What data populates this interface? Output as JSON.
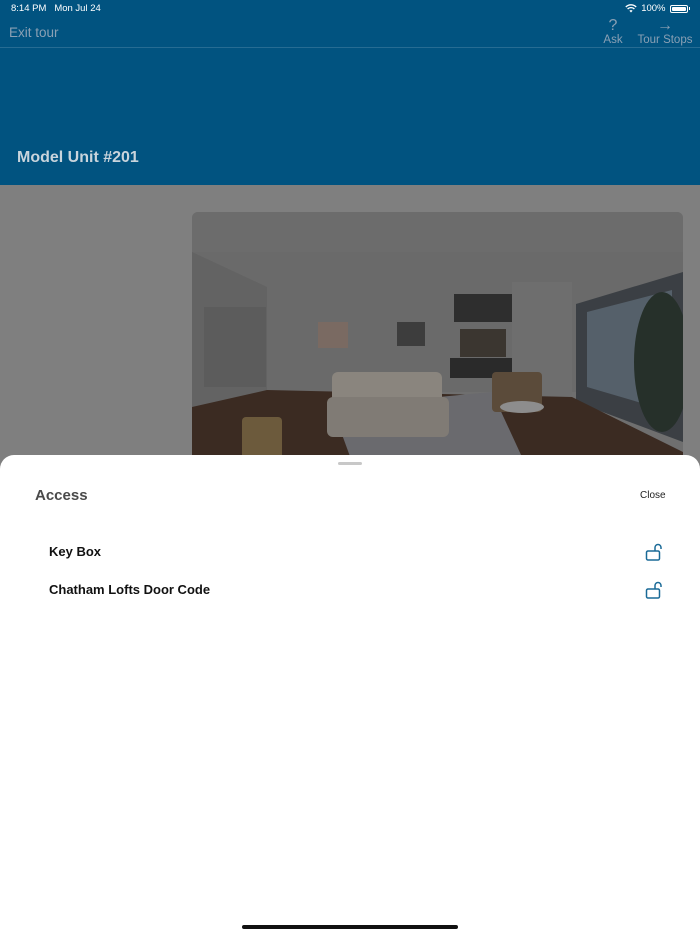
{
  "status": {
    "time": "8:14 PM",
    "date": "Mon Jul 24",
    "battery": "100%"
  },
  "nav": {
    "exit_label": "Exit tour",
    "ask_label": "Ask",
    "tour_stops_label": "Tour Stops"
  },
  "page": {
    "title": "Model Unit #201"
  },
  "sheet": {
    "title": "Access",
    "close_label": "Close",
    "items": [
      {
        "label": "Key Box",
        "icon": "unlock-icon"
      },
      {
        "label": "Chatham Lofts Door Code",
        "icon": "unlock-icon"
      }
    ]
  },
  "colors": {
    "brand": "#015380",
    "accent": "#1a6a97"
  }
}
